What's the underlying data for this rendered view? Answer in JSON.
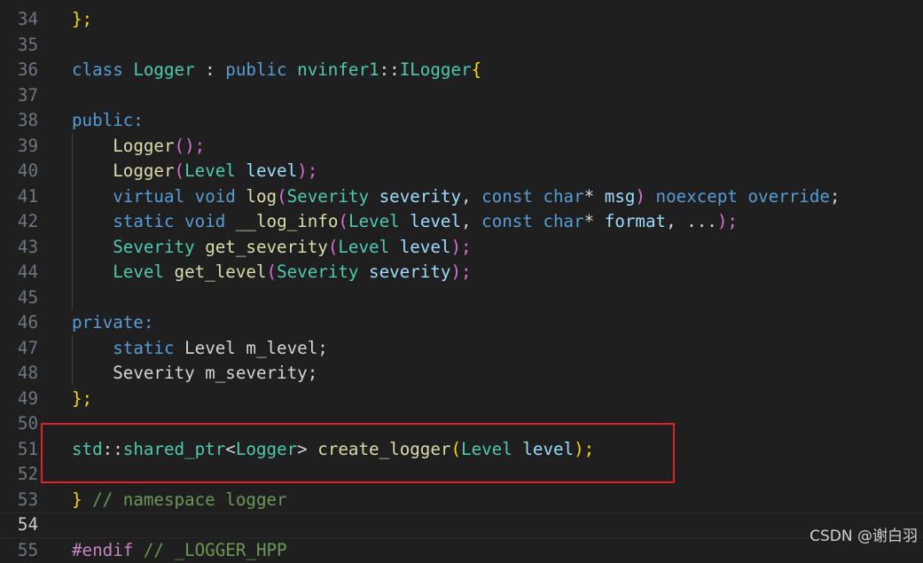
{
  "editor": {
    "lines": [
      {
        "num": "34",
        "tokens": [
          {
            "t": "};",
            "c": "br1"
          }
        ]
      },
      {
        "num": "35",
        "tokens": []
      },
      {
        "num": "36",
        "tokens": [
          {
            "t": "class ",
            "c": "kw"
          },
          {
            "t": "Logger",
            "c": "ty"
          },
          {
            "t": " : ",
            "c": "tx"
          },
          {
            "t": "public ",
            "c": "kw"
          },
          {
            "t": "nvinfer1",
            "c": "ty"
          },
          {
            "t": "::",
            "c": "tx"
          },
          {
            "t": "ILogger",
            "c": "ty"
          },
          {
            "t": "{",
            "c": "br1"
          }
        ]
      },
      {
        "num": "37",
        "tokens": []
      },
      {
        "num": "38",
        "tokens": [
          {
            "t": "public:",
            "c": "kw"
          }
        ]
      },
      {
        "num": "39",
        "tokens": [
          {
            "t": "    ",
            "c": "tx"
          },
          {
            "t": "Logger",
            "c": "fn"
          },
          {
            "t": "();",
            "c": "br2"
          }
        ]
      },
      {
        "num": "40",
        "tokens": [
          {
            "t": "    ",
            "c": "tx"
          },
          {
            "t": "Logger",
            "c": "fn"
          },
          {
            "t": "(",
            "c": "br2"
          },
          {
            "t": "Level ",
            "c": "ty"
          },
          {
            "t": "level",
            "c": "va"
          },
          {
            "t": ");",
            "c": "br2"
          }
        ]
      },
      {
        "num": "41",
        "tokens": [
          {
            "t": "    ",
            "c": "tx"
          },
          {
            "t": "virtual ",
            "c": "kw"
          },
          {
            "t": "void ",
            "c": "kw"
          },
          {
            "t": "log",
            "c": "fn"
          },
          {
            "t": "(",
            "c": "br2"
          },
          {
            "t": "Severity ",
            "c": "ty"
          },
          {
            "t": "severity",
            "c": "va"
          },
          {
            "t": ", ",
            "c": "tx"
          },
          {
            "t": "const ",
            "c": "kw"
          },
          {
            "t": "char",
            "c": "kw"
          },
          {
            "t": "* ",
            "c": "tx"
          },
          {
            "t": "msg",
            "c": "va"
          },
          {
            "t": ")",
            "c": "br2"
          },
          {
            "t": " noexcept override",
            "c": "kw"
          },
          {
            "t": ";",
            "c": "tx"
          }
        ]
      },
      {
        "num": "42",
        "tokens": [
          {
            "t": "    ",
            "c": "tx"
          },
          {
            "t": "static ",
            "c": "kw"
          },
          {
            "t": "void ",
            "c": "kw"
          },
          {
            "t": "__log_info",
            "c": "fn"
          },
          {
            "t": "(",
            "c": "br2"
          },
          {
            "t": "Level ",
            "c": "ty"
          },
          {
            "t": "level",
            "c": "va"
          },
          {
            "t": ", ",
            "c": "tx"
          },
          {
            "t": "const ",
            "c": "kw"
          },
          {
            "t": "char",
            "c": "kw"
          },
          {
            "t": "* ",
            "c": "tx"
          },
          {
            "t": "format",
            "c": "va"
          },
          {
            "t": ", ...",
            "c": "tx"
          },
          {
            "t": ");",
            "c": "br2"
          }
        ]
      },
      {
        "num": "43",
        "tokens": [
          {
            "t": "    ",
            "c": "tx"
          },
          {
            "t": "Severity ",
            "c": "ty"
          },
          {
            "t": "get_severity",
            "c": "fn"
          },
          {
            "t": "(",
            "c": "br2"
          },
          {
            "t": "Level ",
            "c": "ty"
          },
          {
            "t": "level",
            "c": "va"
          },
          {
            "t": ");",
            "c": "br2"
          }
        ]
      },
      {
        "num": "44",
        "tokens": [
          {
            "t": "    ",
            "c": "tx"
          },
          {
            "t": "Level ",
            "c": "ty"
          },
          {
            "t": "get_level",
            "c": "fn"
          },
          {
            "t": "(",
            "c": "br2"
          },
          {
            "t": "Severity ",
            "c": "ty"
          },
          {
            "t": "severity",
            "c": "va"
          },
          {
            "t": ");",
            "c": "br2"
          }
        ]
      },
      {
        "num": "45",
        "tokens": []
      },
      {
        "num": "46",
        "tokens": [
          {
            "t": "private:",
            "c": "kw"
          }
        ]
      },
      {
        "num": "47",
        "tokens": [
          {
            "t": "    ",
            "c": "tx"
          },
          {
            "t": "static ",
            "c": "kw"
          },
          {
            "t": "Level ",
            "c": "tx"
          },
          {
            "t": "m_level;",
            "c": "tx"
          }
        ]
      },
      {
        "num": "48",
        "tokens": [
          {
            "t": "    ",
            "c": "tx"
          },
          {
            "t": "Severity ",
            "c": "tx"
          },
          {
            "t": "m_severity;",
            "c": "tx"
          }
        ]
      },
      {
        "num": "49",
        "tokens": [
          {
            "t": "};",
            "c": "br1"
          }
        ]
      },
      {
        "num": "50",
        "tokens": []
      },
      {
        "num": "51",
        "tokens": [
          {
            "t": "std",
            "c": "ty"
          },
          {
            "t": "::",
            "c": "tx"
          },
          {
            "t": "shared_ptr",
            "c": "ty"
          },
          {
            "t": "<",
            "c": "tx"
          },
          {
            "t": "Logger",
            "c": "ty"
          },
          {
            "t": "> ",
            "c": "tx"
          },
          {
            "t": "create_logger",
            "c": "fn"
          },
          {
            "t": "(",
            "c": "br1"
          },
          {
            "t": "Level ",
            "c": "ty"
          },
          {
            "t": "level",
            "c": "va"
          },
          {
            "t": ");",
            "c": "br1"
          }
        ]
      },
      {
        "num": "52",
        "tokens": []
      },
      {
        "num": "53",
        "tokens": [
          {
            "t": "}",
            "c": "br1"
          },
          {
            "t": " // namespace logger",
            "c": "cm"
          }
        ]
      },
      {
        "num": "54",
        "tokens": [],
        "active": true
      },
      {
        "num": "55",
        "tokens": [
          {
            "t": "#endif ",
            "c": "pp"
          },
          {
            "t": "// _LOGGER_HPP",
            "c": "cm"
          }
        ]
      }
    ]
  },
  "watermark": "CSDN @谢白羽"
}
